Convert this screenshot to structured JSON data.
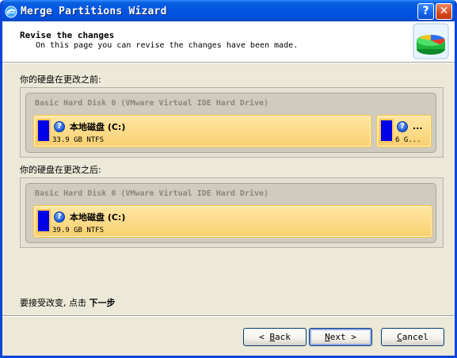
{
  "window": {
    "title": "Merge Partitions Wizard",
    "help_symbol": "?",
    "close_symbol": "✕"
  },
  "header": {
    "title": "Revise the changes",
    "subtitle": "On this page you can revise the changes have been made."
  },
  "before": {
    "label": "你的硬盘在更改之前:",
    "disk_title": "Basic Hard Disk 0 (VMware Virtual IDE Hard Drive)",
    "partitions": [
      {
        "name": "本地磁盘 (C:)",
        "size": "33.9 GB NTFS"
      },
      {
        "name": "...",
        "size": "6 G..."
      }
    ]
  },
  "after": {
    "label": "你的硬盘在更改之后:",
    "disk_title": "Basic Hard Disk 0 (VMware Virtual IDE Hard Drive)",
    "partitions": [
      {
        "name": "本地磁盘 (C:)",
        "size": "39.9 GB NTFS"
      }
    ]
  },
  "footer": {
    "instruction": "要接受改变, 点击",
    "instruction_emphasis": "下一步"
  },
  "buttons": {
    "back_arrow": "<",
    "back_key": "B",
    "back_rest": "ack",
    "next_key": "N",
    "next_rest": "ext",
    "next_arrow": ">",
    "cancel_key": "C",
    "cancel_rest": "ancel"
  },
  "colors": {
    "title_bar": "#0054e3",
    "partition_fill": "#fcd985",
    "partition_bar": "#0000e8"
  }
}
